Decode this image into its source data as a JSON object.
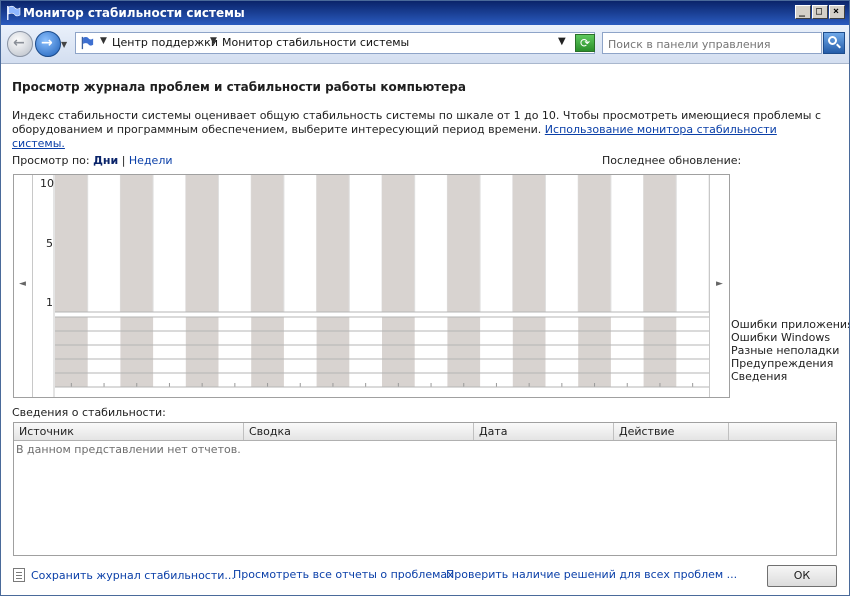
{
  "window": {
    "title": "Монитор стабильности системы",
    "controls": {
      "minimize": "_",
      "maximize": "□",
      "close": "×"
    }
  },
  "navbar": {
    "back_icon": "back-arrow-icon",
    "forward_icon": "forward-arrow-icon",
    "breadcrumb": [
      "Центр поддержки",
      "Монитор стабильности системы"
    ],
    "search_placeholder": "Поиск в панели управления"
  },
  "content": {
    "heading": "Просмотр журнала проблем и стабильности работы компьютера",
    "description": "Индекс стабильности системы оценивает общую стабильность системы по шкале от 1 до 10. Чтобы просмотреть имеющиеся проблемы с оборудованием и программным обеспечением, выберите интересующий период времени.",
    "description_link": "Использование монитора стабильности системы.",
    "view_by_label": "Просмотр по:",
    "view_days": "Дни",
    "view_separator": "|",
    "view_weeks": "Недели",
    "last_update_label": "Последнее обновление:"
  },
  "chart": {
    "y_ticks": [
      "10",
      "5",
      "1"
    ],
    "columns": 20,
    "legend": [
      "Ошибки приложения",
      "Ошибки Windows",
      "Разные неполадки",
      "Предупреждения",
      "Сведения"
    ],
    "colors": {
      "shaded": "#d8d3d0",
      "grid": "#b5b5b5"
    }
  },
  "details": {
    "label": "Сведения о стабильности:",
    "columns": [
      "Источник",
      "Сводка",
      "Дата",
      "Действие"
    ],
    "empty_message": "В данном представлении нет отчетов."
  },
  "footer": {
    "save_link": "Сохранить журнал стабильности...",
    "all_reports_link": "Просмотреть все отчеты о проблемах",
    "check_solutions_link": "Проверить наличие решений для всех проблем ...",
    "ok_label": "ОК"
  }
}
